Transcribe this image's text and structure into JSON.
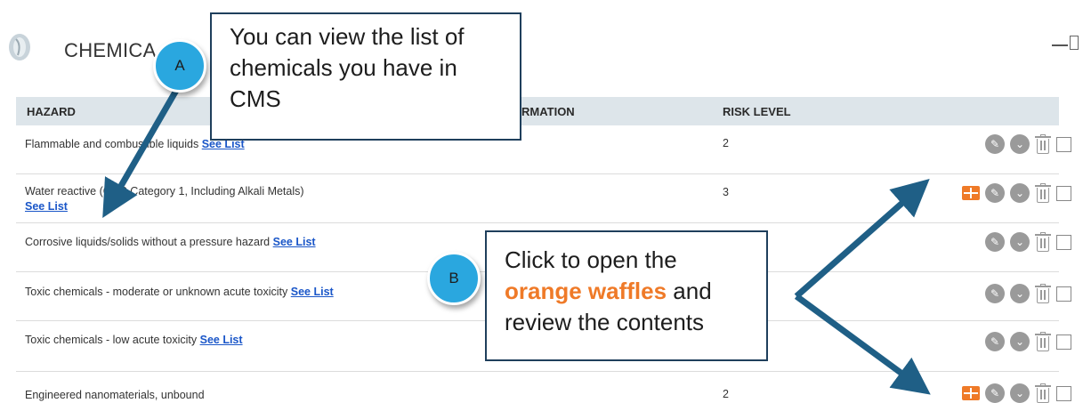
{
  "section": {
    "title": "CHEMICA"
  },
  "table": {
    "headers": {
      "hazard": "HAZARD",
      "information": "RMATION",
      "risk": "RISK LEVEL"
    },
    "rows": [
      {
        "hazard": "Flammable and combustible liquids",
        "link": "See List",
        "risk": "2",
        "waffle": false
      },
      {
        "hazard": "Water reactive (GHS Category 1, Including Alkali Metals)",
        "link": "See List",
        "risk": "3",
        "waffle": true
      },
      {
        "hazard": "Corrosive liquids/solids without a pressure hazard",
        "link": "See List",
        "risk": "",
        "waffle": false
      },
      {
        "hazard": "Toxic chemicals - moderate or unknown acute toxicity",
        "link": "See List",
        "risk": "",
        "waffle": false
      },
      {
        "hazard": "Toxic chemicals - low acute toxicity",
        "link": "See List",
        "risk": "",
        "waffle": false
      },
      {
        "hazard": "Engineered nanomaterials, unbound",
        "link": "",
        "risk": "2",
        "waffle": true
      }
    ]
  },
  "callout_a": {
    "badge": "A",
    "line1": "You can view the list of",
    "line2": "chemicals you have in",
    "line3": "CMS"
  },
  "callout_b": {
    "badge": "B",
    "line1": "Click to open the",
    "highlight": "orange waffles",
    "line2_rest": " and",
    "line3": "review the contents"
  },
  "icons": {
    "edit": "pencil-icon",
    "expand": "chevron-down-icon",
    "delete": "trash-icon",
    "waffle": "waffle-icon"
  },
  "colors": {
    "waffle": "#ef7a28",
    "badge": "#2aa7df",
    "arrow": "#1f5f86",
    "link": "#1a56c8",
    "header_bg": "#dde5ea"
  }
}
